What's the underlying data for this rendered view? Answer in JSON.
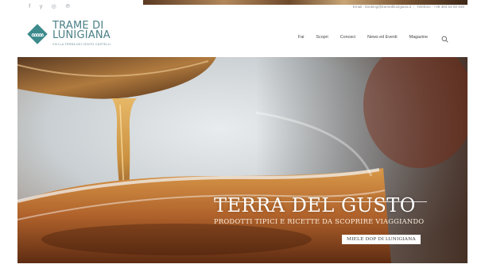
{
  "topbar": {
    "social_icons": [
      "facebook-icon",
      "twitter-icon",
      "instagram-icon",
      "pinterest-icon"
    ],
    "social_glyphs": [
      "f",
      "y",
      "◎",
      "℗"
    ],
    "email": "Email : booking@tramedilunigiana.it",
    "phone": "Telefono : +39 393 63 00 649"
  },
  "header": {
    "logo_line1": "TRAME DI",
    "logo_line2": "LUNIGIANA",
    "logo_tagline": "VIVI LA TERRA DEI CENTO CASTELLI",
    "brand_color": "#3c8a8c"
  },
  "nav": {
    "items": [
      "Fai",
      "Scopri",
      "Conosci",
      "News ed Eventi",
      "Magazine"
    ],
    "search_icon": "search-icon"
  },
  "hero": {
    "title": "TERRA DEL GUSTO",
    "subtitle": "PRODOTTI TIPICI E RICETTE DA SCOPRIRE VIAGGIANDO",
    "button": "MIELE DOP DI LUNIGIANA"
  }
}
